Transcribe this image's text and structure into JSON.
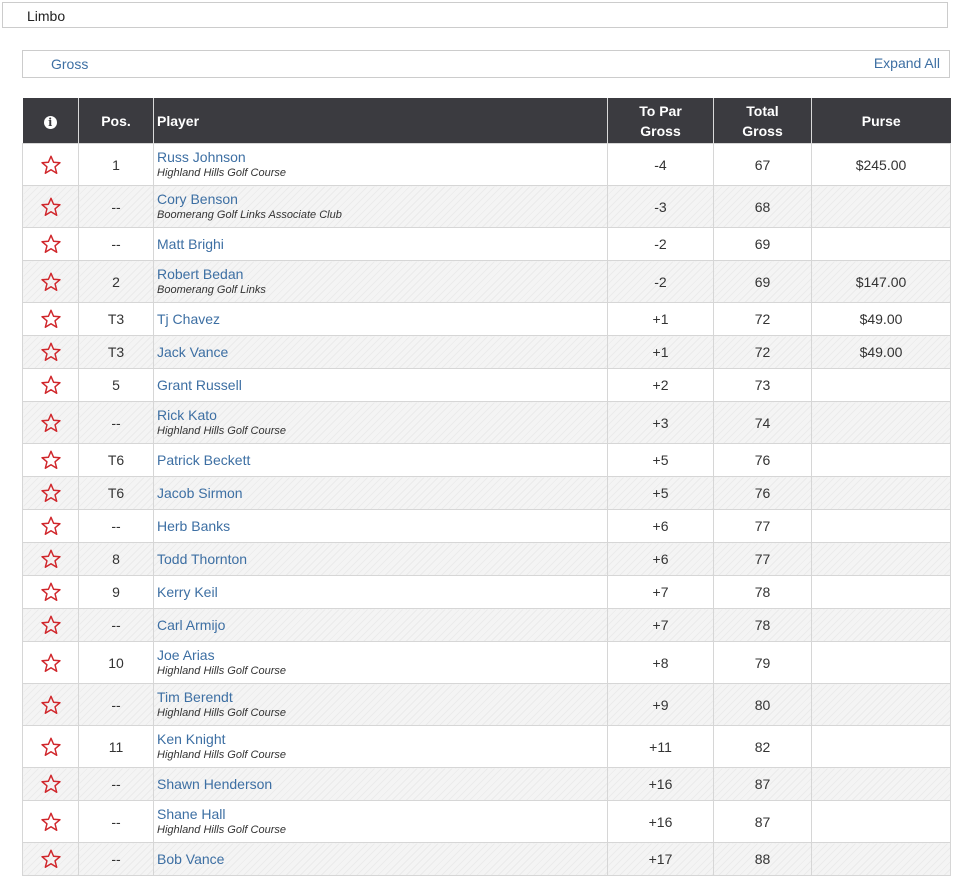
{
  "flight": {
    "name": "Limbo"
  },
  "tabs": {
    "gross_label": "Gross",
    "expand_all_label": "Expand All"
  },
  "colors": {
    "header_bg": "#3b3b40",
    "link": "#3d6fa3",
    "star": "#d0262b"
  },
  "table": {
    "headers": {
      "info": "i",
      "pos": "Pos.",
      "player": "Player",
      "to_par_line1": "To Par",
      "to_par_line2": "Gross",
      "total_line1": "Total",
      "total_line2": "Gross",
      "purse": "Purse"
    },
    "rows": [
      {
        "pos": "1",
        "name": "Russ Johnson",
        "club": "Highland Hills Golf Course",
        "to_par": "-4",
        "total": "67",
        "purse": "$245.00"
      },
      {
        "pos": "--",
        "name": "Cory Benson",
        "club": "Boomerang Golf Links Associate Club",
        "to_par": "-3",
        "total": "68",
        "purse": ""
      },
      {
        "pos": "--",
        "name": "Matt Brighi",
        "club": "",
        "to_par": "-2",
        "total": "69",
        "purse": ""
      },
      {
        "pos": "2",
        "name": "Robert Bedan",
        "club": "Boomerang Golf Links",
        "to_par": "-2",
        "total": "69",
        "purse": "$147.00"
      },
      {
        "pos": "T3",
        "name": "Tj Chavez",
        "club": "",
        "to_par": "+1",
        "total": "72",
        "purse": "$49.00"
      },
      {
        "pos": "T3",
        "name": "Jack Vance",
        "club": "",
        "to_par": "+1",
        "total": "72",
        "purse": "$49.00"
      },
      {
        "pos": "5",
        "name": "Grant Russell",
        "club": "",
        "to_par": "+2",
        "total": "73",
        "purse": ""
      },
      {
        "pos": "--",
        "name": "Rick Kato",
        "club": "Highland Hills Golf Course",
        "to_par": "+3",
        "total": "74",
        "purse": ""
      },
      {
        "pos": "T6",
        "name": "Patrick Beckett",
        "club": "",
        "to_par": "+5",
        "total": "76",
        "purse": ""
      },
      {
        "pos": "T6",
        "name": "Jacob Sirmon",
        "club": "",
        "to_par": "+5",
        "total": "76",
        "purse": ""
      },
      {
        "pos": "--",
        "name": "Herb Banks",
        "club": "",
        "to_par": "+6",
        "total": "77",
        "purse": ""
      },
      {
        "pos": "8",
        "name": "Todd Thornton",
        "club": "",
        "to_par": "+6",
        "total": "77",
        "purse": ""
      },
      {
        "pos": "9",
        "name": "Kerry Keil",
        "club": "",
        "to_par": "+7",
        "total": "78",
        "purse": ""
      },
      {
        "pos": "--",
        "name": "Carl Armijo",
        "club": "",
        "to_par": "+7",
        "total": "78",
        "purse": ""
      },
      {
        "pos": "10",
        "name": "Joe Arias",
        "club": "Highland Hills Golf Course",
        "to_par": "+8",
        "total": "79",
        "purse": ""
      },
      {
        "pos": "--",
        "name": "Tim Berendt",
        "club": "Highland Hills Golf Course",
        "to_par": "+9",
        "total": "80",
        "purse": ""
      },
      {
        "pos": "11",
        "name": "Ken Knight",
        "club": "Highland Hills Golf Course",
        "to_par": "+11",
        "total": "82",
        "purse": ""
      },
      {
        "pos": "--",
        "name": "Shawn Henderson",
        "club": "",
        "to_par": "+16",
        "total": "87",
        "purse": ""
      },
      {
        "pos": "--",
        "name": "Shane Hall",
        "club": "Highland Hills Golf Course",
        "to_par": "+16",
        "total": "87",
        "purse": ""
      },
      {
        "pos": "--",
        "name": "Bob Vance",
        "club": "",
        "to_par": "+17",
        "total": "88",
        "purse": ""
      }
    ]
  }
}
